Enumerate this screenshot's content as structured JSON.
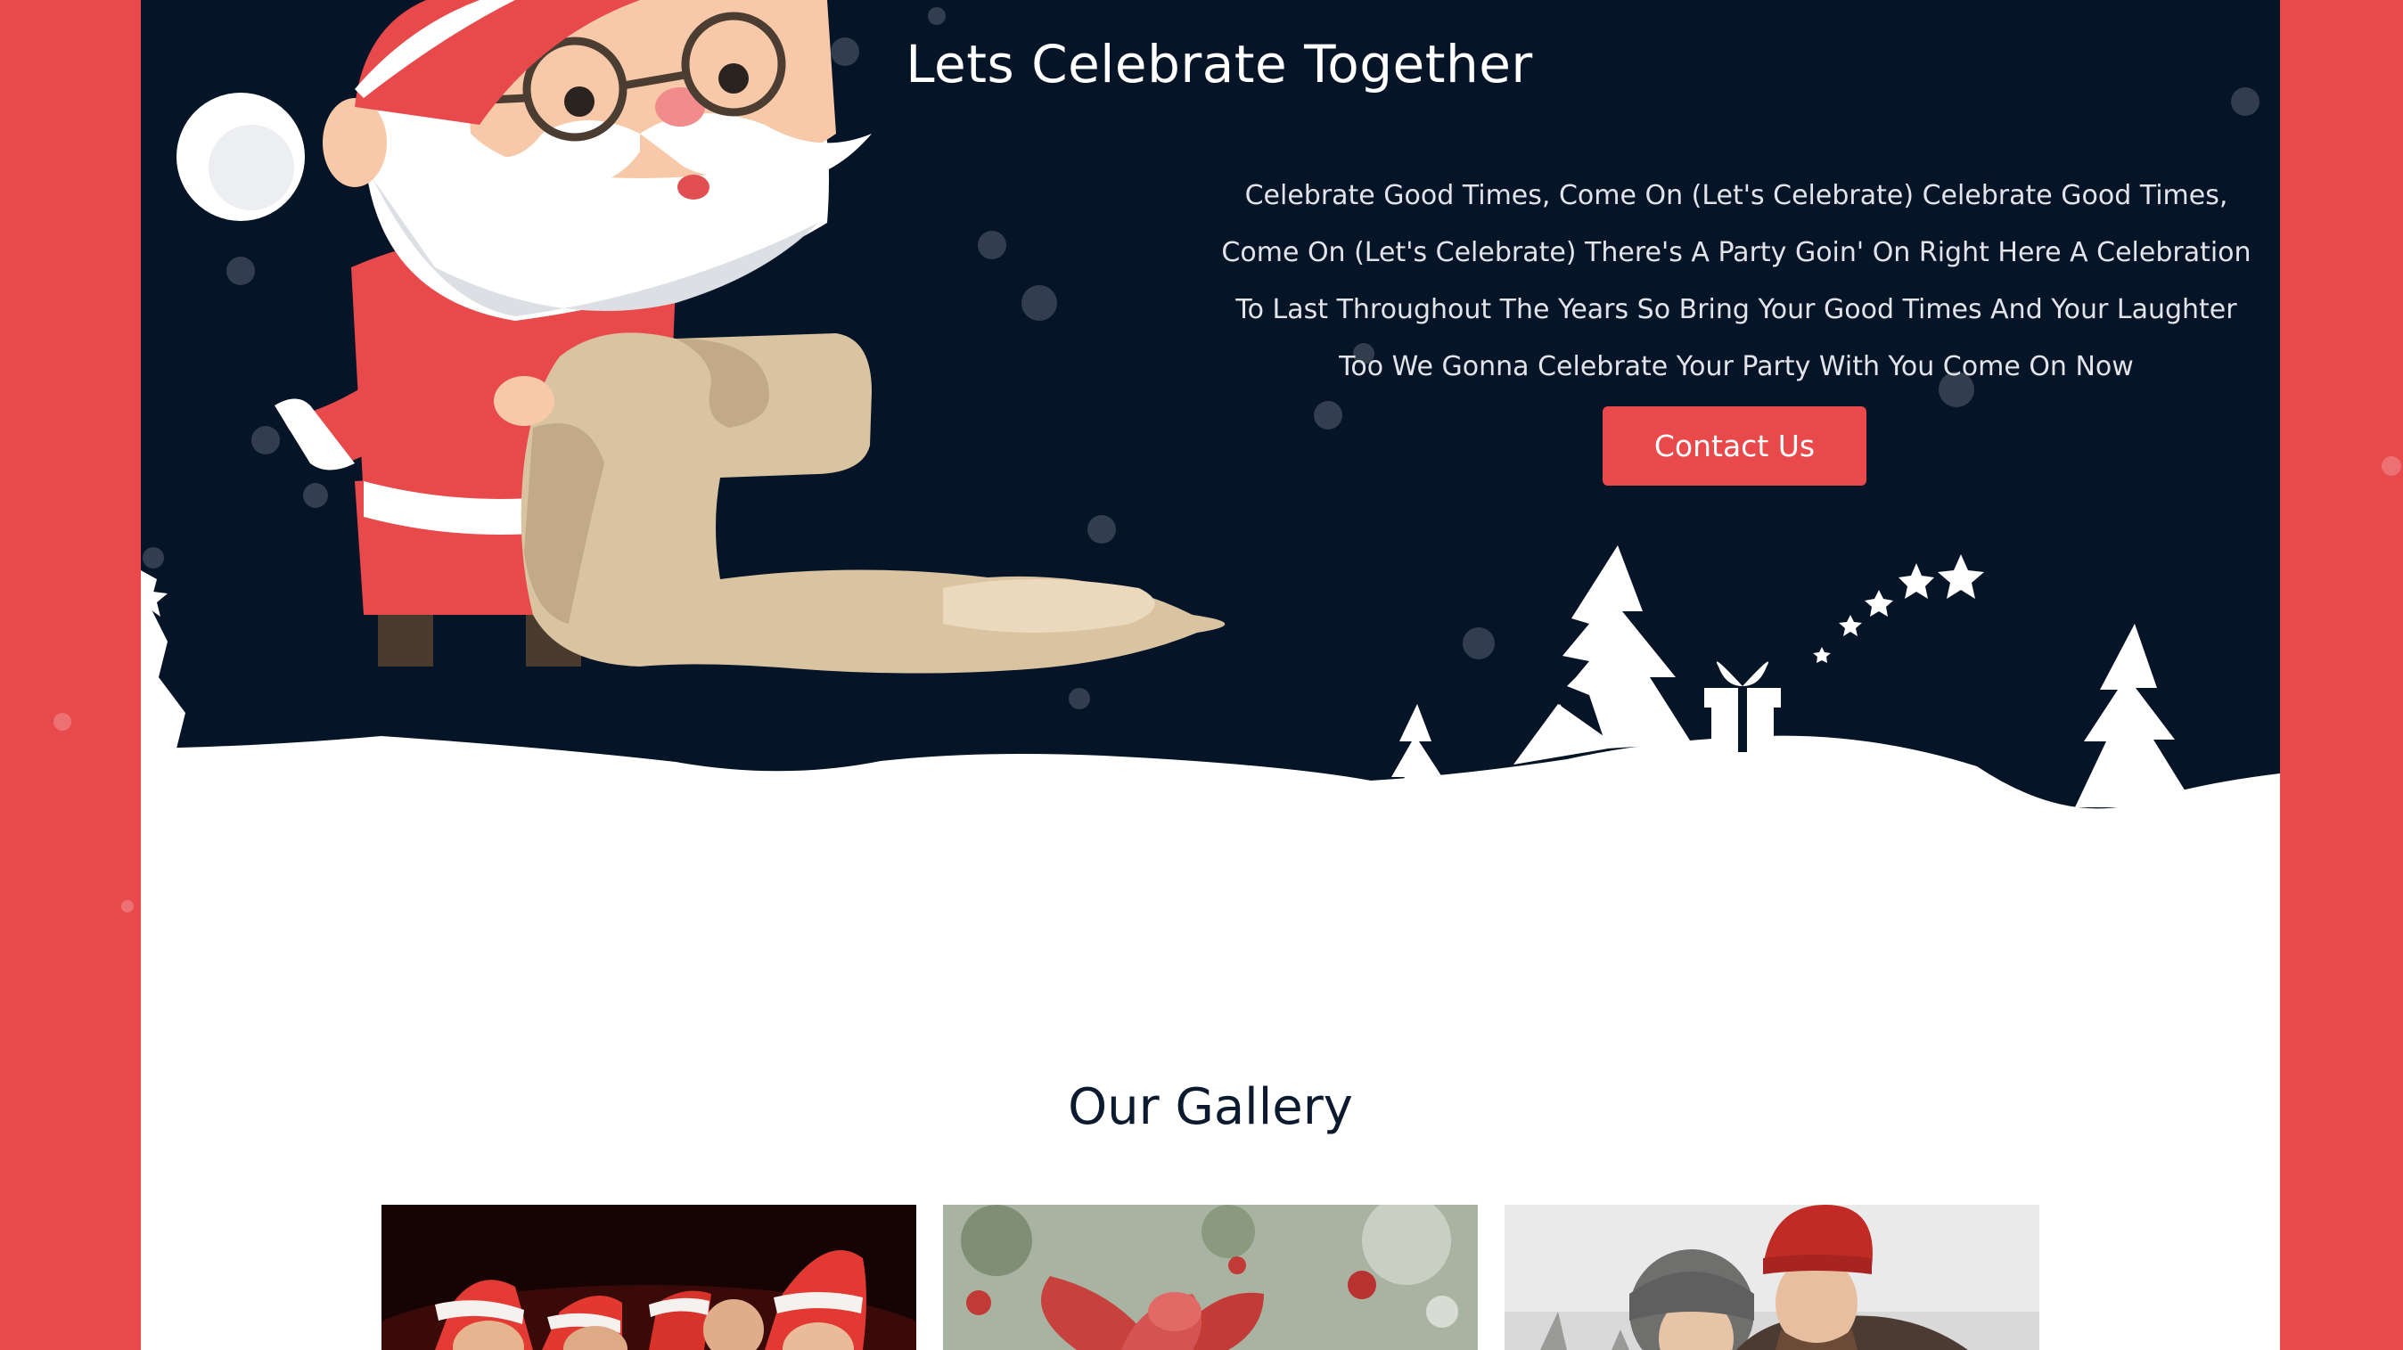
{
  "hero": {
    "title": "Lets Celebrate Together",
    "text": "Celebrate Good Times, Come On (Let's Celebrate) Celebrate Good Times, Come On (Let's Celebrate) There's A Party Goin' On Right Here A Celebration To Last Throughout The Years So Bring Your Good Times And Your Laughter Too We Gonna Celebrate Your Party With You Come On Now",
    "button_label": "Contact Us"
  },
  "gallery": {
    "title": "Our Gallery",
    "items": [
      {
        "name": "gallery-image-santa-hats-group"
      },
      {
        "name": "gallery-image-red-ribbon-gift"
      },
      {
        "name": "gallery-image-winter-couple"
      }
    ]
  },
  "colors": {
    "accent": "#e84a4c",
    "hero_bg": "#061428",
    "snow": "#ffffff",
    "heading": "#0b1a2e"
  }
}
